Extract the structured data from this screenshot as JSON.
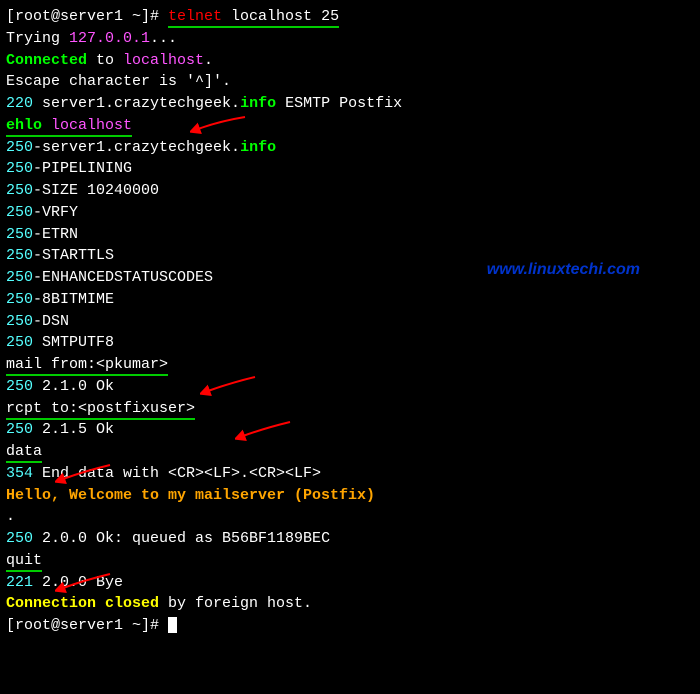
{
  "watermark": "www.linuxtechi.com",
  "lines": {
    "l1a": "[root@server1 ~]# ",
    "l1b": "telnet",
    "l1c": " localhost 25",
    "l2a": "Trying ",
    "l2b": "127.0.0.1",
    "l2c": "...",
    "l3a": "Connected",
    "l3b": " to ",
    "l3c": "localhost",
    "l3d": ".",
    "l4": "Escape character is '^]'.",
    "l5a": "220",
    "l5b": " server1.crazytechgeek.",
    "l5c": "info",
    "l5d": " ESMTP Postfix",
    "l6a": "ehlo",
    "l6b": " localhost",
    "l7a": "250",
    "l7b": "-server1.crazytechgeek.",
    "l7c": "info",
    "l8a": "250",
    "l8b": "-PIPELINING",
    "l9a": "250",
    "l9b": "-SIZE 10240000",
    "l10a": "250",
    "l10b": "-VRFY",
    "l11a": "250",
    "l11b": "-ETRN",
    "l12a": "250",
    "l12b": "-STARTTLS",
    "l13a": "250",
    "l13b": "-ENHANCEDSTATUSCODES",
    "l14a": "250",
    "l14b": "-8BITMIME",
    "l15a": "250",
    "l15b": "-DSN",
    "l16a": "250",
    "l16b": " SMTPUTF8",
    "l17": "mail from:<pkumar>",
    "l18a": "250",
    "l18b": " 2.1.0 Ok",
    "l19": "rcpt to:<postfixuser>",
    "l20a": "250",
    "l20b": " 2.1.5 Ok",
    "l21": "data",
    "l22a": "354",
    "l22b": " End data with <CR><LF>.<CR><LF>",
    "l23": "Hello, Welcome to my mailserver (Postfix)",
    "l24": ".",
    "l25a": "250",
    "l25b": " 2.0.0 Ok: queued as B56BF1189BEC",
    "l26": "quit",
    "l27a": "221",
    "l27b": " 2.0.0 Bye",
    "l28a": "Connection closed",
    "l28b": " by foreign host.",
    "l29": "[root@server1 ~]# "
  }
}
